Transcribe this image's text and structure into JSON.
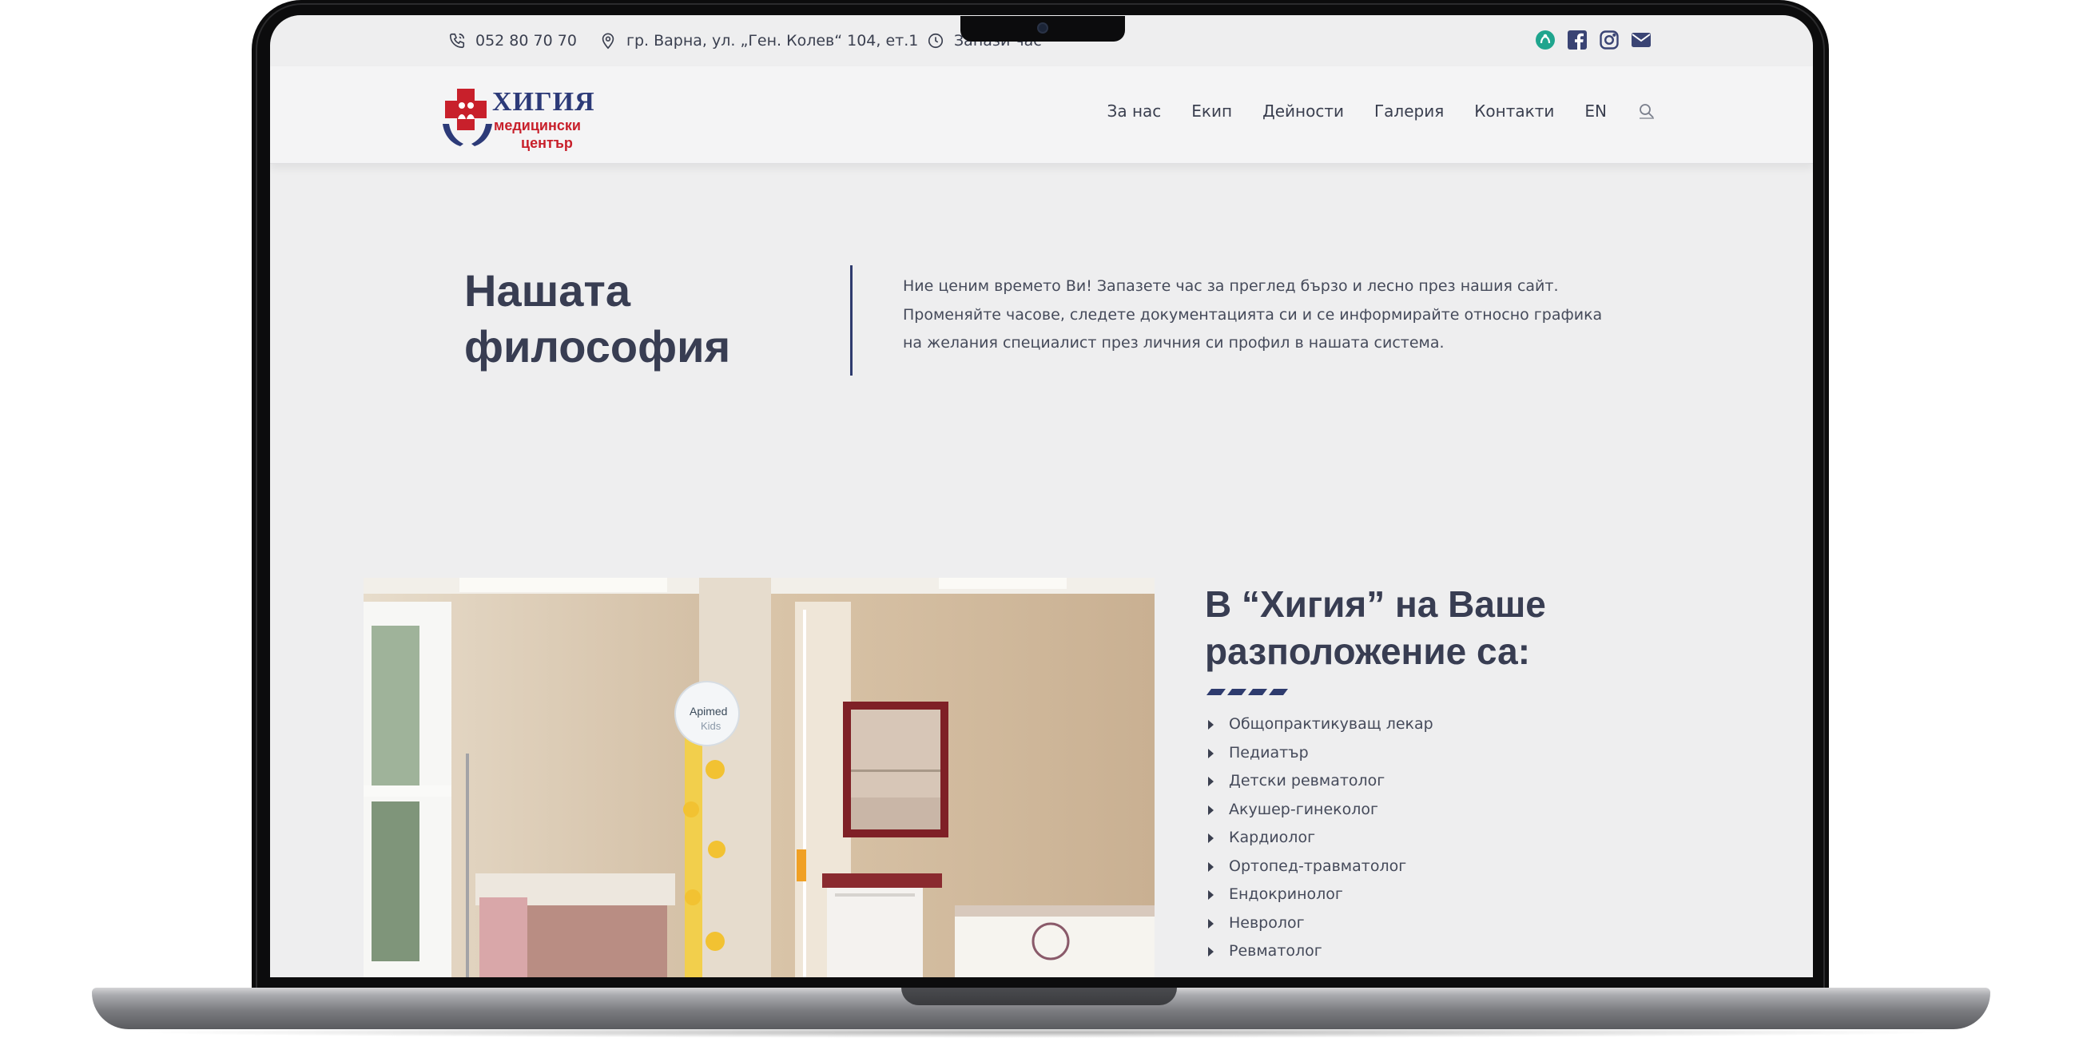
{
  "topbar": {
    "phone": "052 80 70 70",
    "address": "гр. Варна, ул. „Ген. Колев“ 104, ет.1",
    "appointment": "Запази час",
    "icons": [
      "phone-icon",
      "location-pin-icon",
      "clock-icon"
    ],
    "social": [
      "healthcare-app-icon",
      "facebook-icon",
      "instagram-icon",
      "email-icon"
    ]
  },
  "logo": {
    "title": "ХИГИЯ",
    "sub1": "медицински",
    "sub2": "център"
  },
  "nav": {
    "items": [
      "За нас",
      "Екип",
      "Дейности",
      "Галерия",
      "Контакти",
      "EN"
    ]
  },
  "philosophy": {
    "title": "Нашата философия",
    "text": "Ние ценим времето Ви! Запазете час за преглед бързо и лесно през нашия сайт. Променяйте часове, следете документацията си и се информирайте относно графика на желания специалист през личния си профил в нашата система."
  },
  "services": {
    "title": "В “Хигия” на Ваше разположение са:",
    "items": [
      "Общопрактикуващ лекар",
      "Педиатър",
      "Детски ревматолог",
      "Акушер-гинеколог",
      "Кардиолог",
      "Ортопед-травматолог",
      "Ендокринолог",
      "Невролог",
      "Ревматолог"
    ]
  },
  "photo": {
    "poster_text_1": "Apimed",
    "poster_text_2": "Kids"
  },
  "colors": {
    "navy": "#2e3b6e",
    "heading": "#383d52",
    "text": "#454a5a",
    "logo_red": "#c8202b",
    "logo_blue": "#2c3a78",
    "background": "#eeeeef"
  }
}
